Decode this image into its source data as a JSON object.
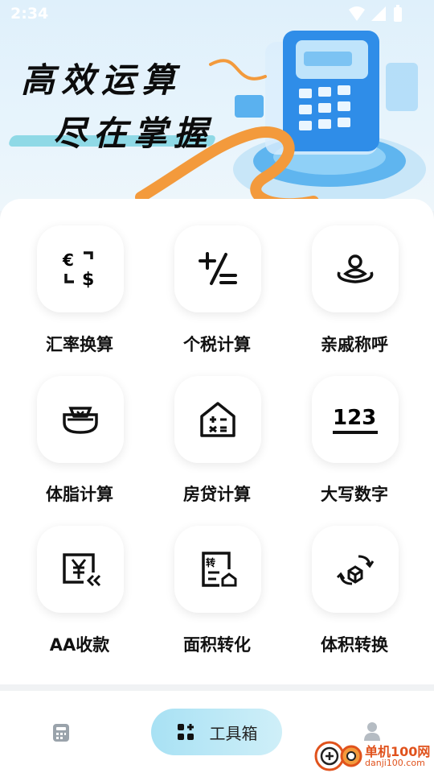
{
  "status_bar": {
    "time": "2:34"
  },
  "banner": {
    "line1": "高效运算",
    "line2": "尽在掌握"
  },
  "tools": [
    {
      "label": "汇率换算",
      "icon": "currency-exchange-icon"
    },
    {
      "label": "个税计算",
      "icon": "plus-minus-icon"
    },
    {
      "label": "亲戚称呼",
      "icon": "people-icon"
    },
    {
      "label": "体脂计算",
      "icon": "body-fat-scale-icon"
    },
    {
      "label": "房贷计算",
      "icon": "house-calc-icon"
    },
    {
      "label": "大写数字",
      "icon": "number-123-icon",
      "icon_text": "123"
    },
    {
      "label": "AA收款",
      "icon": "yen-split-icon"
    },
    {
      "label": "面积转化",
      "icon": "area-convert-icon"
    },
    {
      "label": "体积转换",
      "icon": "volume-convert-icon"
    }
  ],
  "bottom_nav": {
    "tools_label": "工具箱"
  },
  "watermark": {
    "brand": "单机100网",
    "url": "danji100.com"
  },
  "colors": {
    "accent": "#a8e1f4",
    "watermark": "#e0521c"
  }
}
